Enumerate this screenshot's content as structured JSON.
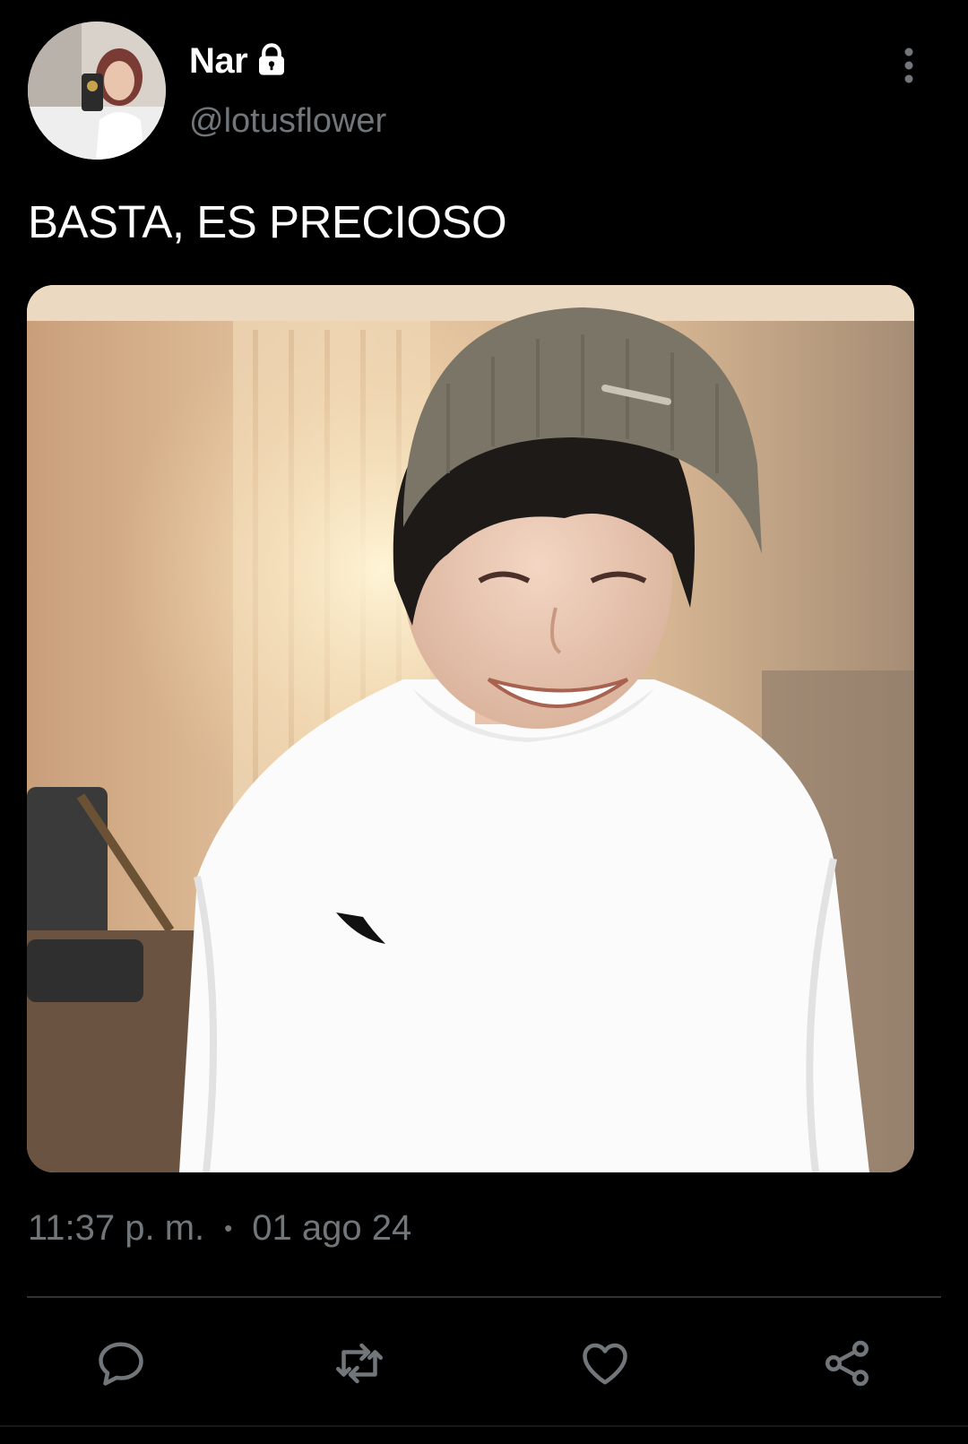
{
  "tweet": {
    "author": {
      "display_name": "Nar",
      "handle": "@lotusflower",
      "protected_icon": "lock-icon"
    },
    "text": "BASTA, ES PRECIOSO",
    "time": "11:37 p. m.",
    "separator": "•",
    "date": "01 ago 24",
    "menu_icon": "more-vertical-icon"
  },
  "actions": [
    {
      "name": "reply",
      "icon": "reply-icon"
    },
    {
      "name": "retweet",
      "icon": "retweet-icon"
    },
    {
      "name": "like",
      "icon": "heart-icon"
    },
    {
      "name": "share",
      "icon": "share-icon"
    }
  ],
  "colors": {
    "background": "#000000",
    "primary_text": "#ffffff",
    "secondary_text": "#71767b",
    "divider": "#2f3336"
  }
}
